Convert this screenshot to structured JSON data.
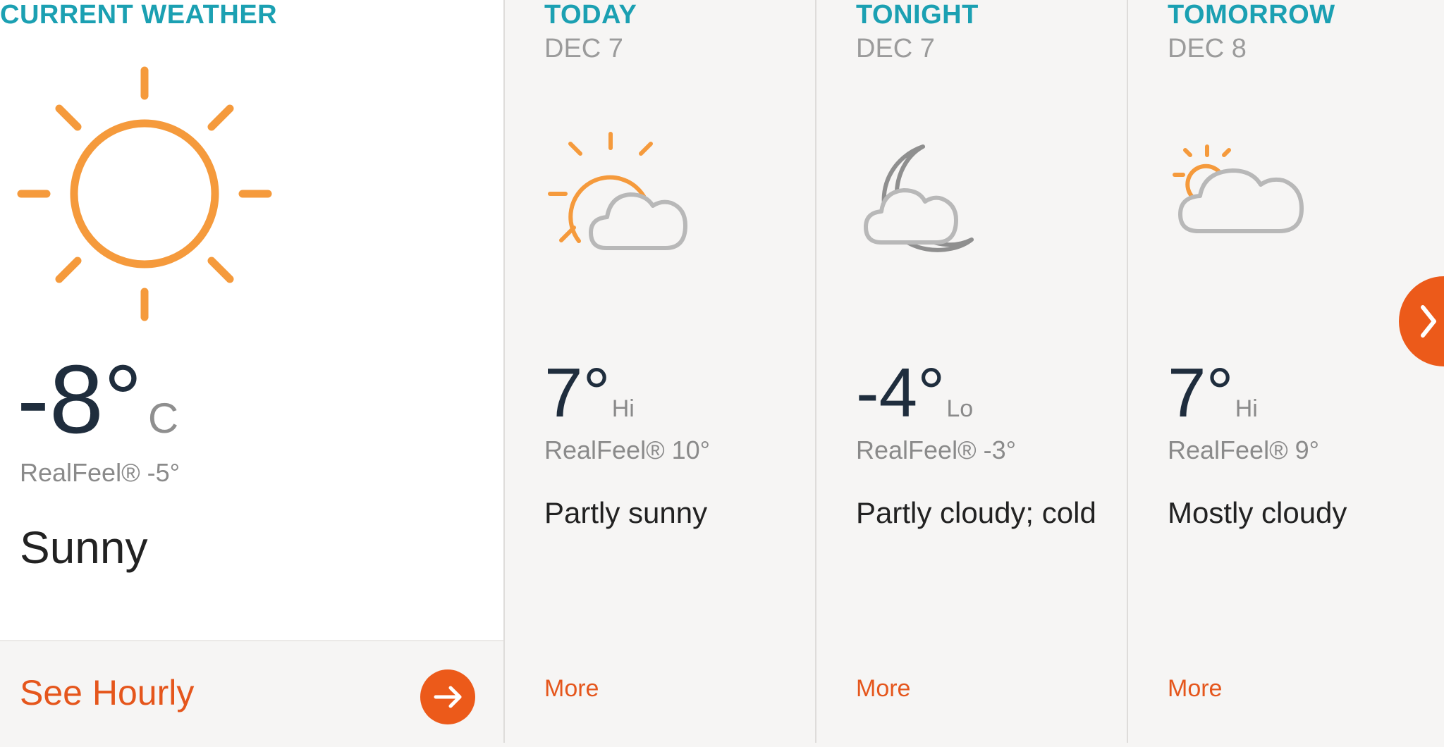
{
  "current": {
    "title": "CURRENT WEATHER",
    "icon": "sun-icon",
    "temp": "-8°",
    "unit": "C",
    "realfeel": "RealFeel® -5°",
    "phrase": "Sunny",
    "hourly_label": "See Hourly"
  },
  "forecast": [
    {
      "label": "TODAY",
      "date": "DEC 7",
      "icon": "partly-sunny-icon",
      "temp": "7°",
      "hilo": "Hi",
      "realfeel": "RealFeel® 10°",
      "phrase": "Partly sunny",
      "more": "More"
    },
    {
      "label": "TONIGHT",
      "date": "DEC 7",
      "icon": "partly-cloudy-night-icon",
      "temp": "-4°",
      "hilo": "Lo",
      "realfeel": "RealFeel® -3°",
      "phrase": "Partly cloudy; cold",
      "more": "More"
    },
    {
      "label": "TOMORROW",
      "date": "DEC 8",
      "icon": "mostly-cloudy-icon",
      "temp": "7°",
      "hilo": "Hi",
      "realfeel": "RealFeel® 9°",
      "phrase": "Mostly cloudy",
      "more": "More"
    }
  ],
  "colors": {
    "accent": "#ec5a1a",
    "heading": "#1ba0b2",
    "sun": "#f59a3c",
    "cloud": "#b8b8b8"
  }
}
